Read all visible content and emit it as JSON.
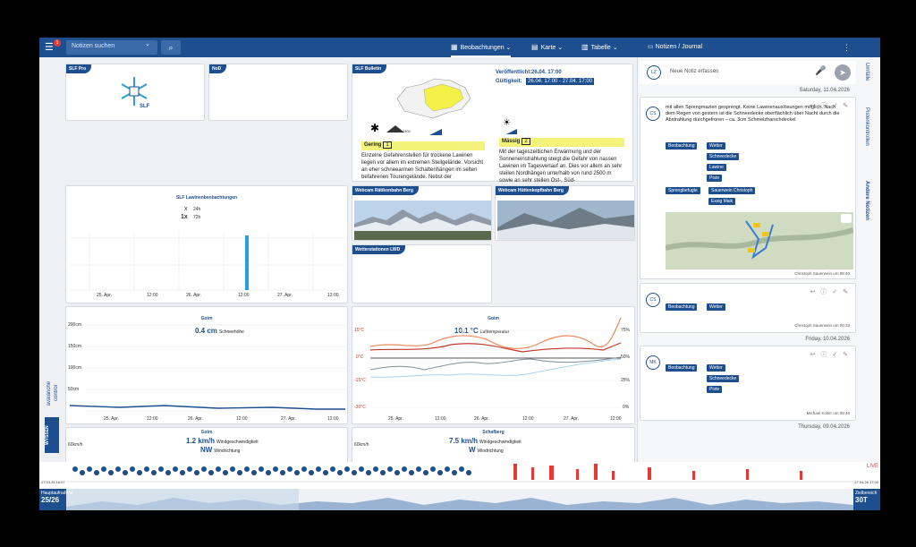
{
  "topbar": {
    "search_placeholder": "Notizen suchen",
    "menu_badge": "1",
    "tabs": [
      {
        "label": "Beobachtungen",
        "icon": "dashboard-icon"
      },
      {
        "label": "Karte",
        "icon": "map-icon"
      },
      {
        "label": "Tabelle",
        "icon": "bar-chart-icon"
      }
    ],
    "notes_title": "Notizen / Journal"
  },
  "cards": {
    "slf_pro": "SLF Pro",
    "nod": "NoD",
    "bulletin": "SLF Bulletin",
    "lawinen": "SLF Lawinenbeobachtungen",
    "webcam1": "Webcam Rätikonbahn Berg",
    "webcam2": "Webcam Hüttenkopfbahn Berg",
    "wetterstationen": "Wetterstationen LWD"
  },
  "bulletin": {
    "published_label": "Veröffentlicht:",
    "published_value": "26.04. 17:00",
    "valid_label": "Gültigkeit:",
    "valid_value": "26.04. 17:00 - 27.04. 17:00",
    "left_level": "Gering",
    "left_level_num": "1",
    "left_text": "Einzelne Gefahrenstellen für trockene Lawinen liegen vor allem im extremen Steilgelände. Vorsicht an eher schneearmen Schattenhängen im selten befahrenen Tourengelände. Nebst der",
    "right_level": "Mässig",
    "right_level_num": "2",
    "right_text": "Mit der tageszeitlichen Erwärmung und der Sonneneinstrahlung steigt die Gefahr von nassen Lawinen im Tagesverlauf an. Dies vor allem an sehr steilen Nordhängen unterhalb von rund 2500 m sowie an sehr steilen Ost-, Süd-",
    "elevation": "2400"
  },
  "lawinen_legend": {
    "l1_mark": "x",
    "l1_period": "24h",
    "l2_mark": "1x",
    "l2_period": "72h"
  },
  "snow_chart": {
    "title": "Goim",
    "value": "0.4 cm",
    "value_label": "Schneehöhe"
  },
  "temp_chart": {
    "title": "Goim",
    "value": "10.1 °C",
    "value_label": "Lufttemperatur"
  },
  "wind1": {
    "title": "Goim",
    "speed": "1.2 km/h",
    "speed_label": "Windgeschwindigkeit",
    "dir": "NW",
    "dir_label": "Windrichtung",
    "ytick": "60km/h"
  },
  "wind2": {
    "title": "Schafberg",
    "speed": "7.5 km/h",
    "speed_label": "Windgeschwindigkeit",
    "dir": "W",
    "dir_label": "Windrichtung",
    "ytick": "60km/h"
  },
  "brand": {
    "line1": "avalanche",
    "line2": "control",
    "logo": "WYSSEN"
  },
  "notes": {
    "input_placeholder": "Neue Notiz erfassen",
    "input_avatar": "LZ",
    "date1": "Saturday, 11.04.2026",
    "date2": "Friday, 10.04.2026",
    "date3": "Thursday, 09.04.2026",
    "items": [
      {
        "avatar": "CS",
        "text": "mit allen Sprengmazien gesprengt. Keine Lawinenauslösungen möglich. Nach dem Regen von gestern ist die Schneedecke oberflächlich über Nacht durch die Abstrahlung durchgefroren – ca. 3cm Schmelzharschdeckel",
        "chips": [
          "Beobachtung",
          "Wetter",
          "Schneedecke",
          "Lawine",
          "Piste",
          "Sprengbefugte",
          "Sauerwein Christoph",
          "Essig Maik"
        ],
        "meta": "Christoph Sauerwein um 08:40"
      },
      {
        "avatar": "CS",
        "chips": [
          "Beobachtung",
          "Wetter"
        ],
        "meta": "Christoph Sauerwein um 00:33"
      },
      {
        "avatar": "MK",
        "chips": [
          "Beobachtung",
          "Wetter",
          "Schneedecke",
          "Piste"
        ],
        "meta": "Michael Koller um 09:46"
      }
    ]
  },
  "side_tabs": [
    "Umfälle",
    "Pistenkontrollen",
    "Andere Notizen"
  ],
  "timeline": {
    "live": "LIVE",
    "left_date": "27.03.26 18:57",
    "right_date": "27.04.26 17:00",
    "left_box": "Hauptaufnahme",
    "left_count": "25/26",
    "right_box": "Zielbereich",
    "right_value": "30T"
  }
}
